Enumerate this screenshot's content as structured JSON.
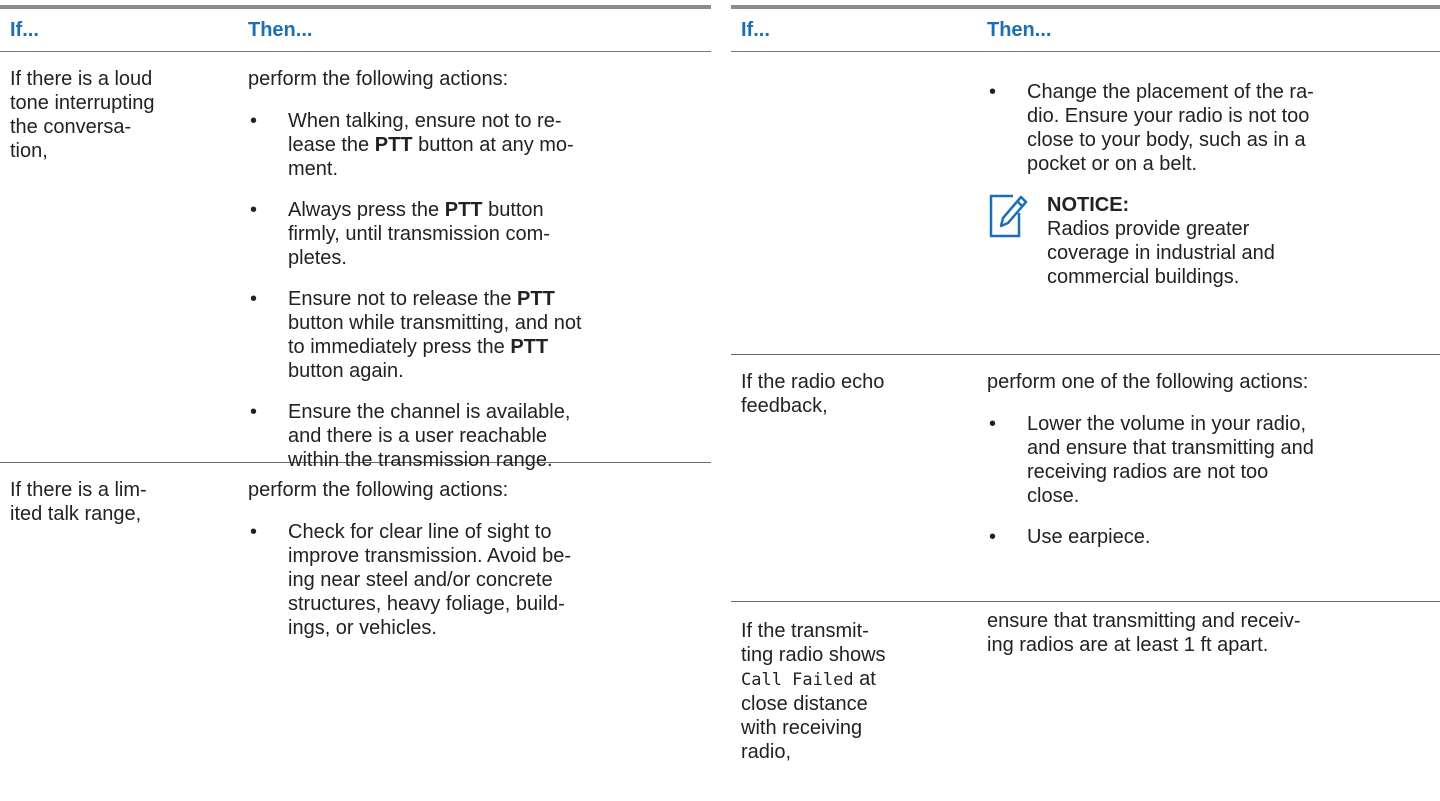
{
  "header": {
    "if_label": "If...",
    "then_label": "Then..."
  },
  "left": {
    "rows": [
      {
        "condition": [
          "If there is a loud",
          "tone interrupting",
          "the conversa-",
          "tion,"
        ],
        "intro": "perform the following actions:",
        "bullets": [
          {
            "lines": [
              [
                "When talking, ensure not to re-"
              ],
              [
                "lease the ",
                "PTT",
                " button at any mo-"
              ],
              [
                "ment."
              ]
            ]
          },
          {
            "lines": [
              [
                "Always press the ",
                "PTT",
                " button"
              ],
              [
                "firmly, until transmission com-"
              ],
              [
                "pletes."
              ]
            ]
          },
          {
            "lines": [
              [
                "Ensure not to release the ",
                "PTT"
              ],
              [
                "button while transmitting, and not"
              ],
              [
                "to immediately press the ",
                "PTT"
              ],
              [
                "button again."
              ]
            ]
          },
          {
            "lines": [
              [
                "Ensure the channel is available,"
              ],
              [
                "and there is a user reachable"
              ],
              [
                "within the transmission range."
              ]
            ]
          }
        ]
      },
      {
        "condition": [
          "If there is a lim-",
          "ited talk range,"
        ],
        "intro": "perform the following actions:",
        "bullets": [
          {
            "lines": [
              [
                "Check for clear line of sight to"
              ],
              [
                "improve transmission. Avoid be-"
              ],
              [
                "ing near steel and/or concrete"
              ],
              [
                "structures, heavy foliage, build-"
              ],
              [
                "ings, or vehicles."
              ]
            ]
          }
        ]
      }
    ]
  },
  "right": {
    "rows": [
      {
        "condition": [],
        "bullets": [
          {
            "lines": [
              [
                "Change the placement of the ra-"
              ],
              [
                "dio. Ensure your radio is not too"
              ],
              [
                "close to your body, such as in a"
              ],
              [
                "pocket or on a belt."
              ]
            ]
          }
        ],
        "notice": {
          "title": "NOTICE:",
          "text": [
            "Radios provide greater",
            "coverage in industrial and",
            "commercial buildings."
          ],
          "icon": "edit-note-icon"
        }
      },
      {
        "condition": [
          "If the radio echo",
          "feedback,"
        ],
        "intro": "perform one of the following actions:",
        "bullets": [
          {
            "lines": [
              [
                "Lower the volume in your radio,"
              ],
              [
                "and ensure that transmitting and"
              ],
              [
                "receiving radios are not too"
              ],
              [
                "close."
              ]
            ]
          },
          {
            "lines": [
              [
                "Use earpiece."
              ]
            ]
          }
        ]
      },
      {
        "condition_parts": {
          "line1": "If the transmit-",
          "line2": "ting radio shows",
          "code": "Call Failed",
          "after_code": " at",
          "line4": "close distance",
          "line5": "with receiving",
          "line6": "radio,"
        },
        "intro_lines": [
          "ensure that transmitting and receiv-",
          "ing radios are at least 1 ft apart."
        ]
      }
    ]
  },
  "colors": {
    "header_text": "#1c6fb7",
    "rule": "#8c8c8c",
    "notice_icon": "#1c6fb7"
  }
}
